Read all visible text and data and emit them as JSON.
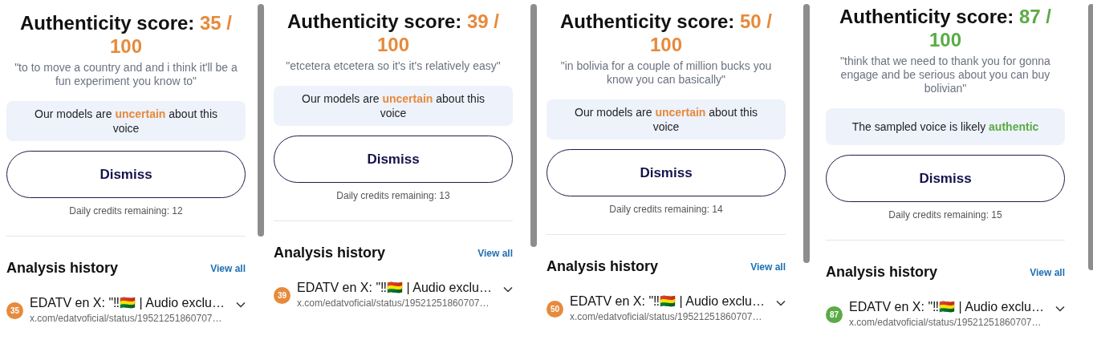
{
  "panels": [
    {
      "score_label": "Authenticity score:",
      "score": "35 / 100",
      "color": "#e68a3c",
      "quote": "\"to to move a country and and i think it'll be a fun experiment you know to\"",
      "verdict": {
        "before": "Our models are ",
        "emphasis": "uncertain",
        "after": " about this voice"
      },
      "dismiss": "Dismiss",
      "credits": "Daily credits remaining: 12",
      "history_title": "Analysis history",
      "view_all": "View all",
      "history": [
        {
          "badge": "35",
          "title": "EDATV en X: \"‼🇧🇴 | Audio exclu…",
          "url": "x.com/edatvoficial/status/19521251860707…"
        }
      ]
    },
    {
      "score_label": "Authenticity score:",
      "score": "39 / 100",
      "color": "#e68a3c",
      "quote": "\"etcetera etcetera so it's it's relatively easy\"",
      "verdict": {
        "before": "Our models are ",
        "emphasis": "uncertain",
        "after": " about this voice"
      },
      "dismiss": "Dismiss",
      "credits": "Daily credits remaining: 13",
      "history_title": "Analysis history",
      "view_all": "View all",
      "history": [
        {
          "badge": "39",
          "title": "EDATV en X: \"‼🇧🇴 | Audio exclu…",
          "url": "x.com/edatvoficial/status/19521251860707…"
        }
      ]
    },
    {
      "score_label": "Authenticity score:",
      "score": "50 / 100",
      "color": "#e68a3c",
      "quote": "\"in bolivia for a couple of million bucks you know you can basically\"",
      "verdict": {
        "before": "Our models are ",
        "emphasis": "uncertain",
        "after": " about this voice"
      },
      "dismiss": "Dismiss",
      "credits": "Daily credits remaining: 14",
      "history_title": "Analysis history",
      "view_all": "View all",
      "history": [
        {
          "badge": "50",
          "title": "EDATV en X: \"‼🇧🇴 | Audio exclu…",
          "url": "x.com/edatvoficial/status/19521251860707…"
        }
      ]
    },
    {
      "score_label": "Authenticity score:",
      "score": "87 / 100",
      "color": "#5bab45",
      "quote": "\"think that we need to thank you for gonna engage and be serious about you can buy bolivian\"",
      "verdict": {
        "before": "The sampled voice is likely ",
        "emphasis": "authentic"
      },
      "dismiss": "Dismiss",
      "credits": "Daily credits remaining: 15",
      "history_title": "Analysis history",
      "view_all": "View all",
      "history": [
        {
          "badge": "87",
          "title": "EDATV en X: \"‼🇧🇴 | Audio exclu…",
          "url": "x.com/edatvoficial/status/19521251860707…"
        }
      ]
    }
  ]
}
